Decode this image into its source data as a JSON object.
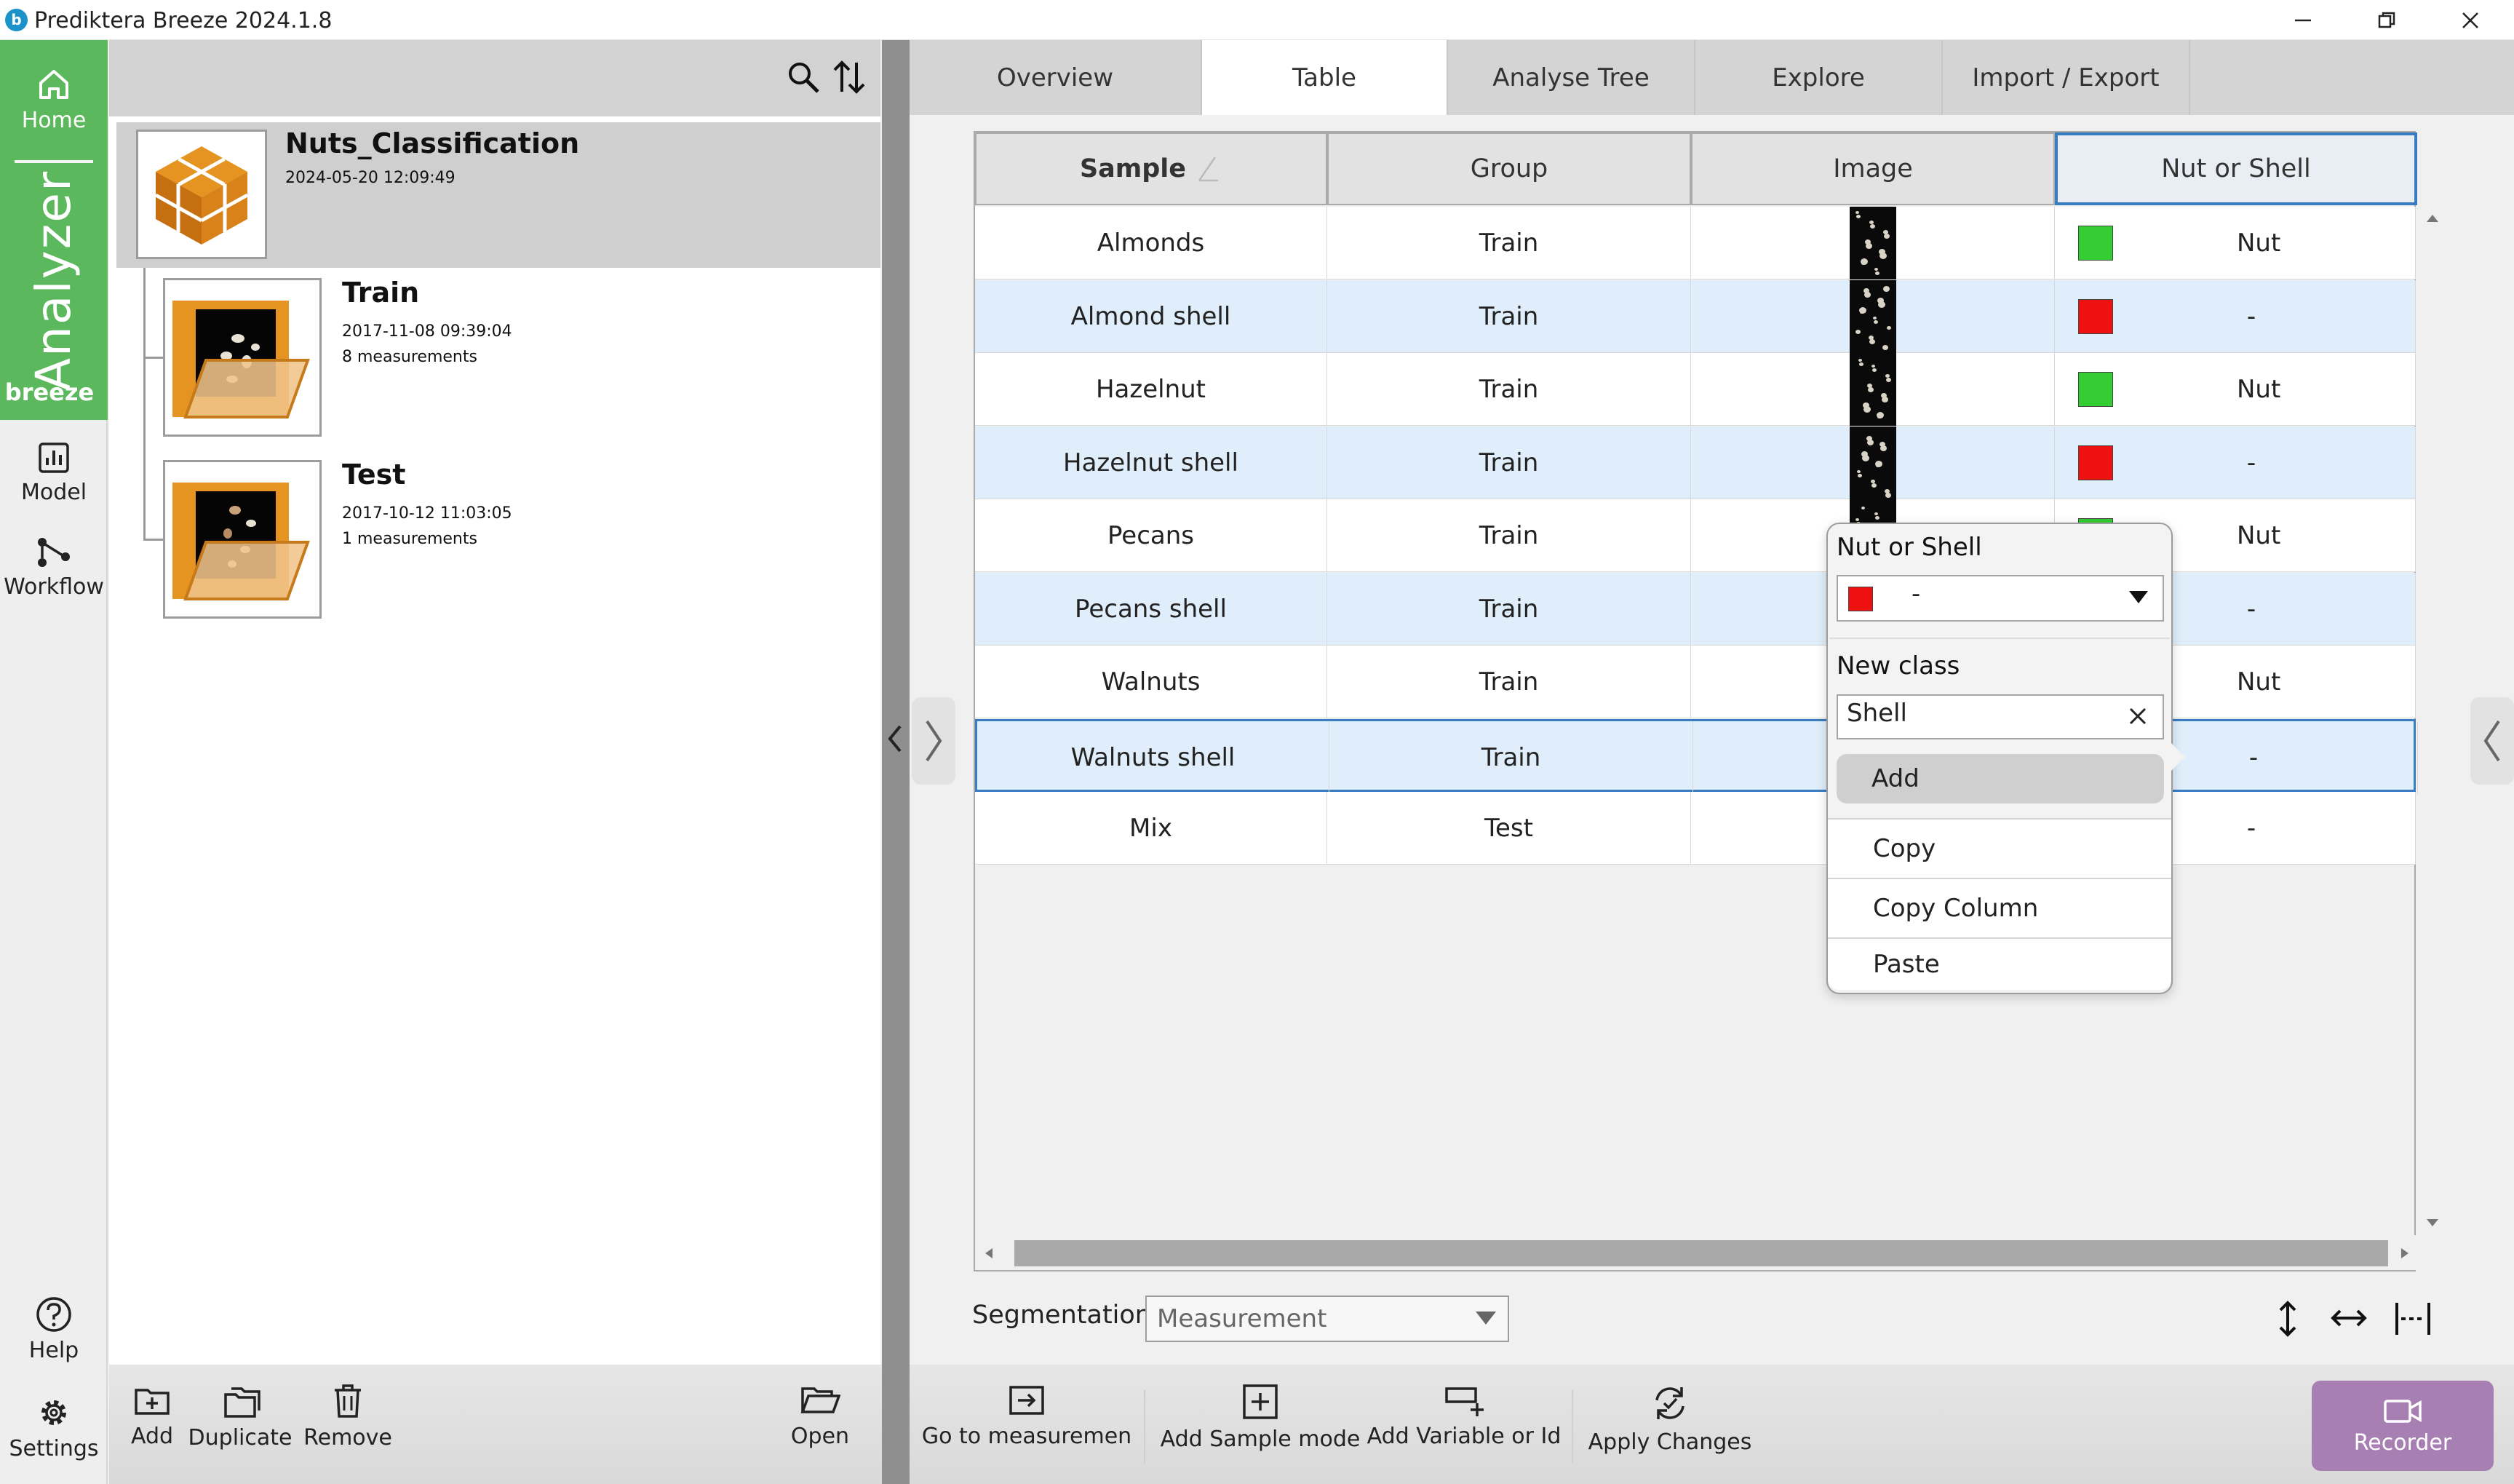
{
  "window": {
    "title": "Prediktera Breeze 2024.1.8",
    "logo_letter": "b"
  },
  "rail": {
    "home": "Home",
    "brand_word": "Analyzer",
    "brand_sub": "breeze",
    "model": "Model",
    "workflow": "Workflow",
    "help": "Help",
    "settings": "Settings"
  },
  "project": {
    "name": "Nuts_Classification",
    "date": "2024-05-20 12:09:49",
    "groups": [
      {
        "name": "Train",
        "date": "2017-11-08 09:39:04",
        "count": "8 measurements"
      },
      {
        "name": "Test",
        "date": "2017-10-12 11:03:05",
        "count": "1 measurements"
      }
    ]
  },
  "left_toolbar": {
    "add": "Add",
    "duplicate": "Duplicate",
    "remove": "Remove",
    "open": "Open"
  },
  "tabs": [
    "Overview",
    "Table",
    "Analyse Tree",
    "Explore",
    "Import / Export"
  ],
  "table": {
    "columns": [
      "Sample",
      "Group",
      "Image",
      "Nut or Shell"
    ],
    "rows": [
      {
        "sample": "Almonds",
        "group": "Train",
        "class": "Nut",
        "color": "#33cc33"
      },
      {
        "sample": "Almond shell",
        "group": "Train",
        "class": "-",
        "color": "#ee1111"
      },
      {
        "sample": "Hazelnut",
        "group": "Train",
        "class": "Nut",
        "color": "#33cc33"
      },
      {
        "sample": "Hazelnut shell",
        "group": "Train",
        "class": "-",
        "color": "#ee1111"
      },
      {
        "sample": "Pecans",
        "group": "Train",
        "class": "Nut",
        "color": "#33cc33"
      },
      {
        "sample": "Pecans shell",
        "group": "Train",
        "class": "-",
        "color": "#ee1111"
      },
      {
        "sample": "Walnuts",
        "group": "Train",
        "class": "Nut",
        "color": "#33cc33"
      },
      {
        "sample": "Walnuts shell",
        "group": "Train",
        "class": "-",
        "color": "#ee1111"
      },
      {
        "sample": "Mix",
        "group": "Test",
        "class": "-",
        "color": "#ee1111"
      }
    ]
  },
  "popup": {
    "title": "Nut or Shell",
    "selected_value": "-",
    "selected_color": "#ee1111",
    "new_class_label": "New class",
    "new_class_value": "Shell",
    "add": "Add",
    "copy": "Copy",
    "copy_column": "Copy Column",
    "paste": "Paste"
  },
  "segmentation": {
    "label": "Segmentation",
    "value": "Measurement"
  },
  "bottom_toolbar": {
    "go_to": "Go to measuremen",
    "add_sample": "Add Sample mode",
    "add_variable": "Add Variable or Id",
    "apply": "Apply Changes",
    "recorder": "Recorder"
  },
  "colors": {
    "accent_green": "#5cb85c",
    "selection_blue": "#3a7cc0",
    "recorder": "#a77fb3"
  }
}
